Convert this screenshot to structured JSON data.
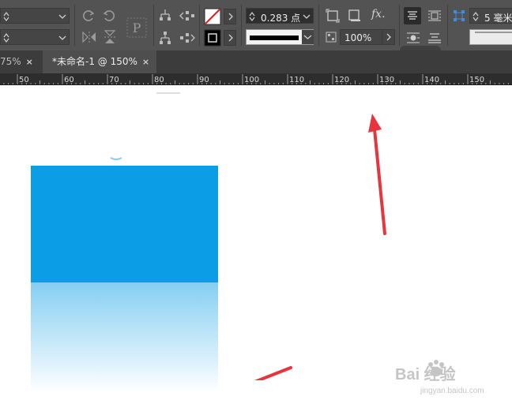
{
  "toolbar": {
    "stroke_weight": "0.283 点",
    "opacity": "100%",
    "effects_label": "fx.",
    "column_value": "5 毫米"
  },
  "tabs": [
    {
      "label": "75%"
    },
    {
      "label": "*未命名-1 @ 150%"
    }
  ],
  "tab_close_glyph": "×",
  "ruler": {
    "ticks": [
      "50",
      "60",
      "70",
      "80",
      "90",
      "100",
      "110",
      "120",
      "130",
      "140",
      "150"
    ]
  },
  "colors": {
    "toolbar_bg": "#535353",
    "tab_bar_bg": "#3c3c3c",
    "active_tab_bg": "#4e4e4e",
    "ruler_bg": "#2d2d2d",
    "shape_fill": "#0b9de6",
    "annotation_arrow": "#e8343c"
  },
  "watermark": {
    "brand": "Bai 经验",
    "url": "jingyan.baidu.com"
  }
}
